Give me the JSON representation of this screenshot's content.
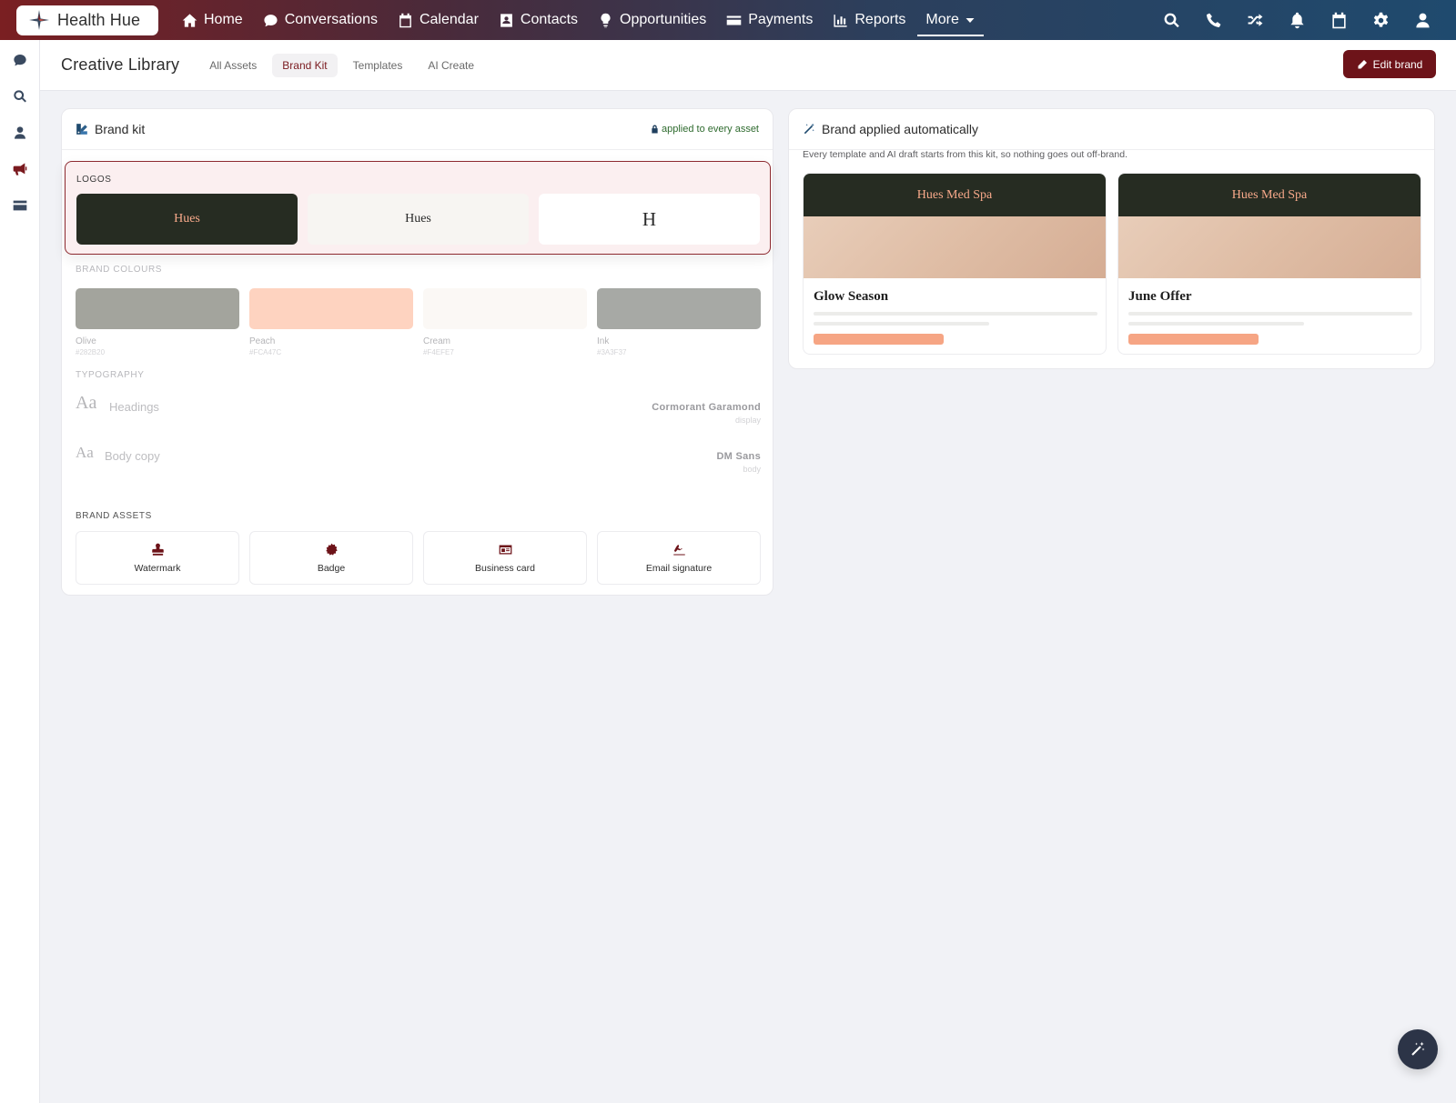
{
  "app": {
    "name": "Health Hue"
  },
  "nav": {
    "items": [
      {
        "label": "Home",
        "icon": "home-icon"
      },
      {
        "label": "Conversations",
        "icon": "chat-icon"
      },
      {
        "label": "Calendar",
        "icon": "calendar-icon"
      },
      {
        "label": "Contacts",
        "icon": "contact-card-icon"
      },
      {
        "label": "Opportunities",
        "icon": "lightbulb-icon"
      },
      {
        "label": "Payments",
        "icon": "credit-card-icon"
      },
      {
        "label": "Reports",
        "icon": "bar-chart-icon"
      },
      {
        "label": "More",
        "icon": "caret-down-icon"
      }
    ],
    "right_icons": [
      "search-icon",
      "phone-icon",
      "shuffle-icon",
      "bell-icon",
      "calendar-icon",
      "gear-icon",
      "user-icon"
    ]
  },
  "rail": {
    "icons": [
      "chat-icon",
      "search-icon",
      "user-icon",
      "megaphone-icon",
      "credit-card-icon"
    ],
    "active": "megaphone-icon"
  },
  "header": {
    "title": "Creative Library",
    "tabs": [
      "All Assets",
      "Brand Kit",
      "Templates",
      "AI Create"
    ],
    "active_tab": "Brand Kit",
    "edit_button": "Edit brand"
  },
  "brand_kit": {
    "title": "Brand kit",
    "applied_note": "applied to every asset",
    "logos": {
      "label": "LOGOS",
      "tiles": [
        {
          "text": "Hues",
          "variant": "dark"
        },
        {
          "text": "Hues",
          "variant": "cream"
        },
        {
          "text": "H",
          "variant": "white"
        }
      ]
    },
    "colours": {
      "label": "BRAND COLOURS",
      "swatches": [
        {
          "name": "Olive",
          "hex": "#282B20",
          "display_color": "#a3a49d"
        },
        {
          "name": "Peach",
          "hex": "#FCA47C",
          "display_color": "#fed3c0"
        },
        {
          "name": "Cream",
          "hex": "#F4EFE7",
          "display_color": "#fbf8f5"
        },
        {
          "name": "Ink",
          "hex": "#3A3F37",
          "display_color": "#a7a9a5"
        }
      ]
    },
    "typography": {
      "label": "TYPOGRAPHY",
      "rows": [
        {
          "sample": "Aa",
          "role": "Headings",
          "font": "Cormorant Garamond",
          "kind": "display"
        },
        {
          "sample": "Aa",
          "role": "Body copy",
          "font": "DM Sans",
          "kind": "body"
        }
      ]
    },
    "assets": {
      "label": "BRAND ASSETS",
      "items": [
        {
          "label": "Watermark",
          "icon": "stamp-icon"
        },
        {
          "label": "Badge",
          "icon": "badge-icon"
        },
        {
          "label": "Business card",
          "icon": "id-card-icon"
        },
        {
          "label": "Email signature",
          "icon": "signature-icon"
        }
      ]
    }
  },
  "auto_brand": {
    "title": "Brand applied automatically",
    "note": "Every template and AI draft starts from this kit, so nothing goes out off-brand.",
    "previews": [
      {
        "brand": "Hues Med Spa",
        "title": "Glow Season"
      },
      {
        "brand": "Hues Med Spa",
        "title": "June Offer"
      }
    ]
  },
  "colors": {
    "accent": "#6d1319",
    "nav_start": "#7a1f22",
    "nav_end": "#1f4a6e",
    "peach": "#f6a584",
    "olive": "#262c22"
  }
}
